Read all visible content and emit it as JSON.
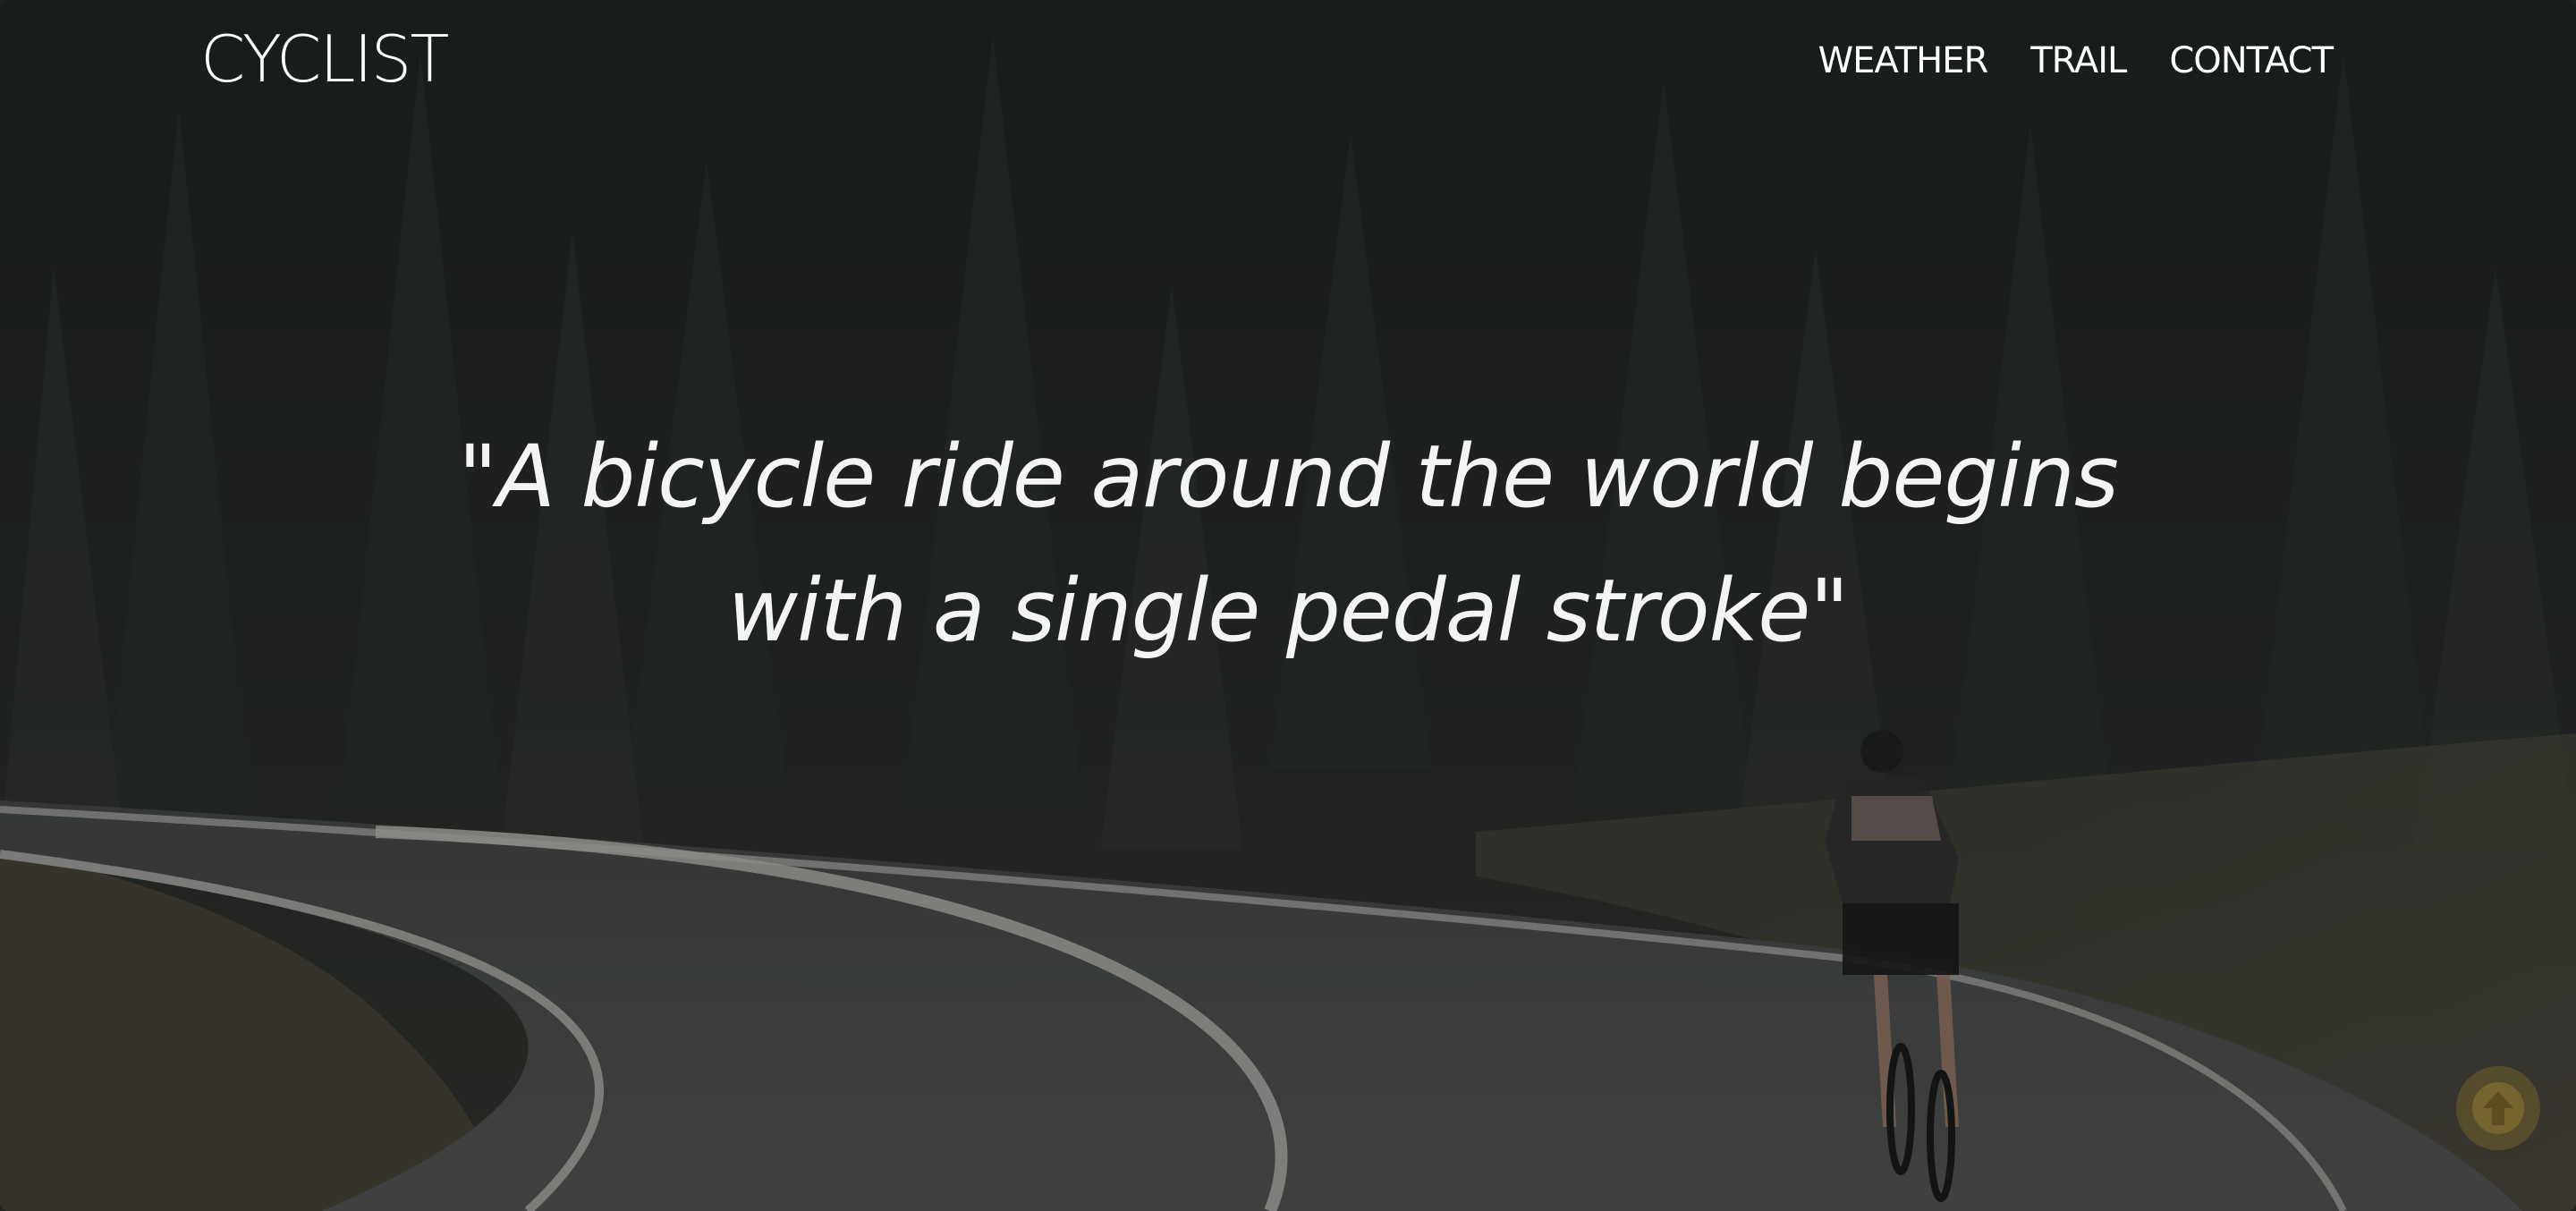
{
  "brand": {
    "logo_text": "CYCLIST"
  },
  "nav": {
    "items": [
      {
        "label": "WEATHER"
      },
      {
        "label": "TRAIL"
      },
      {
        "label": "CONTACT"
      }
    ]
  },
  "hero": {
    "quote_line_1": "\"A bicycle ride around the world begins",
    "quote_line_2": "with a single pedal stroke\""
  },
  "controls": {
    "back_to_top_icon": "arrow-up-circle-icon"
  },
  "colors": {
    "text": "#ffffff",
    "overlay": "#1f2322",
    "back_to_top": "#70602c"
  }
}
